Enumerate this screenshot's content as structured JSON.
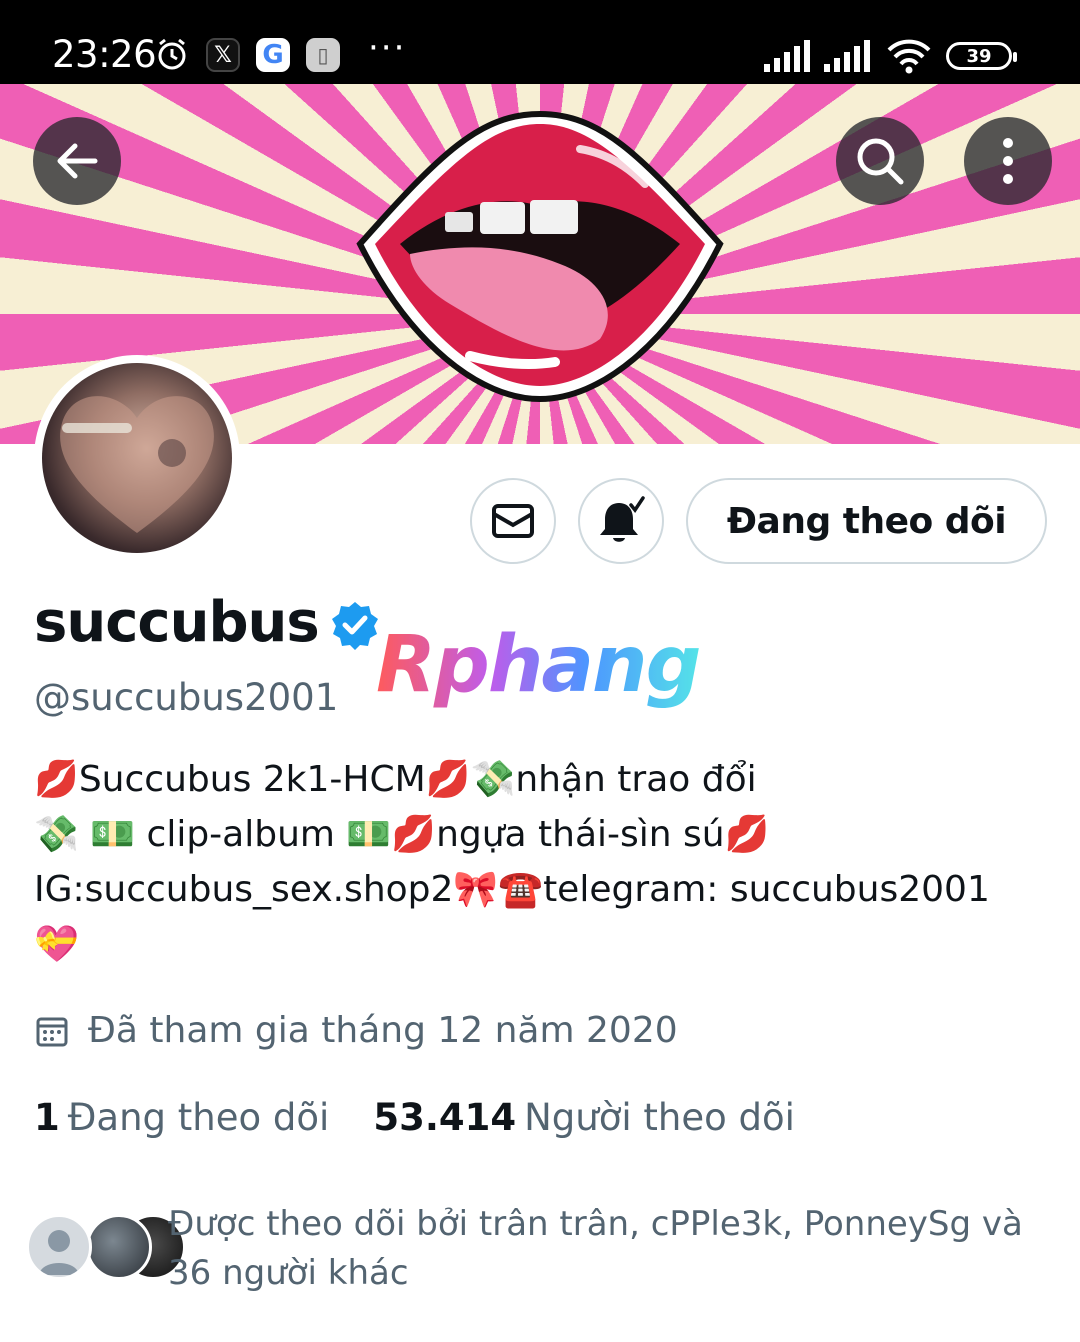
{
  "status_bar": {
    "time": "23:26",
    "battery": "39",
    "icons": [
      "alarm-icon",
      "x-app-icon",
      "google-icon",
      "notification-app-icon",
      "more-dots-icon",
      "signal-icon",
      "signal-icon",
      "wifi-icon",
      "battery-icon"
    ],
    "more": "···"
  },
  "header": {
    "back_icon": "arrow-left-icon",
    "search_icon": "search-icon",
    "menu_icon": "kebab-menu-icon"
  },
  "profile": {
    "display_name": "succubus",
    "verified": true,
    "handle": "@succubus2001",
    "watermark": "Rphang",
    "bio_lines": [
      "💋Succubus 2k1-HCM💋💸nhận trao đổi",
      "💸 💵 clip-album 💵💋ngựa thái-sìn sú💋",
      "IG:succubus_sex.shop2🎀☎️telegram: succubus2001",
      "💝"
    ],
    "joined": "Đã tham gia tháng 12 năm 2020",
    "following_count": "1",
    "following_label": "Đang theo dõi",
    "followers_count": "53.414",
    "followers_label": "Người theo dõi",
    "followed_by": "Được theo dõi bởi trân trân, cPPle3k, PonneySg và 36 người khác"
  },
  "actions": {
    "message_icon": "envelope-icon",
    "notify_icon": "bell-check-icon",
    "follow_label": "Đang theo dõi"
  },
  "colors": {
    "accent": "#1d9bf0",
    "secondary_text": "#536471",
    "border": "#cfd9de",
    "banner_pink": "#ef5fb5",
    "banner_cream": "#f7efd4",
    "lips_red": "#d81f4a"
  }
}
